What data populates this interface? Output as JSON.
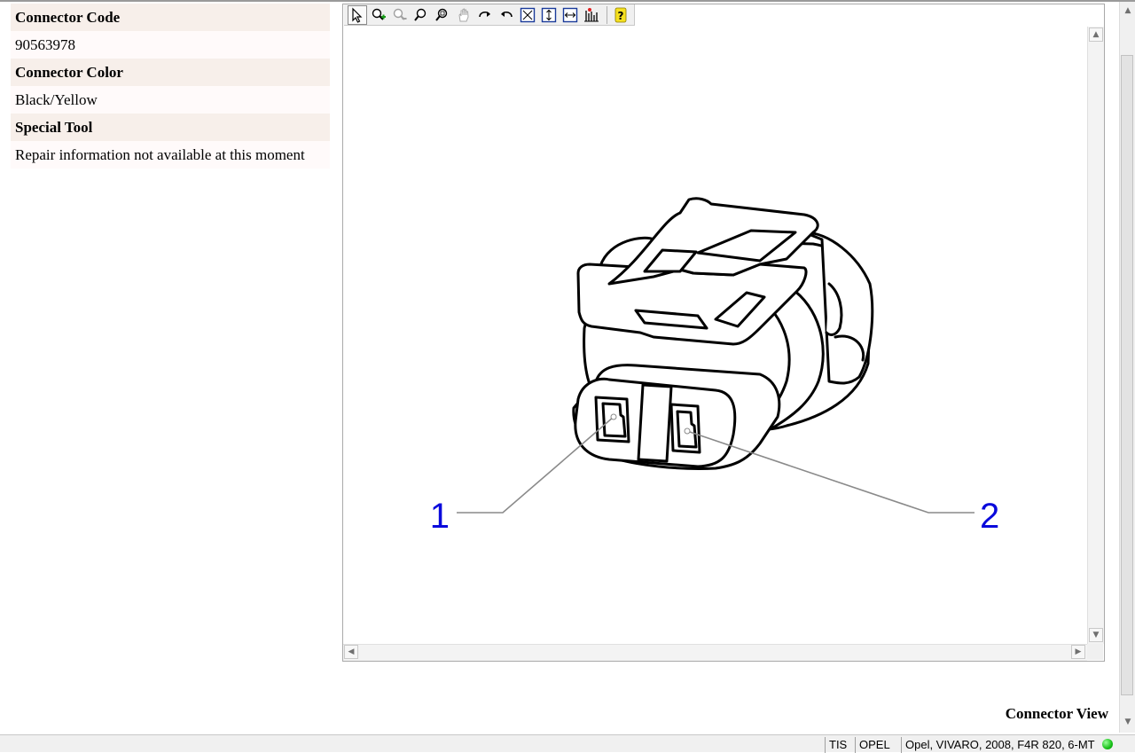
{
  "info_table": {
    "connector_code_label": "Connector Code",
    "connector_code_value": "90563978",
    "connector_color_label": "Connector Color",
    "connector_color_value": "Black/Yellow",
    "special_tool_label": "Special Tool",
    "special_tool_value": "Repair information not available at this moment"
  },
  "toolbar": {
    "tools": [
      "select-arrow-icon",
      "zoom-in-icon",
      "zoom-out-icon",
      "zoom-icon",
      "zoom-window-icon",
      "pan-hand-icon",
      "rotate-cw-icon",
      "rotate-ccw-icon",
      "fit-all-icon",
      "fit-height-icon",
      "fit-width-icon",
      "show-labels-icon",
      "help-icon"
    ],
    "active_tool": "select-arrow-icon"
  },
  "drawing": {
    "pin_labels": [
      "1",
      "2"
    ],
    "label_color": "#0a0adc"
  },
  "caption": "Connector View",
  "status_bar": {
    "app": "TIS",
    "brand": "OPEL",
    "vehicle": "Opel, VIVARO, 2008, F4R 820, 6-MT",
    "status_led_color": "#17c017"
  }
}
